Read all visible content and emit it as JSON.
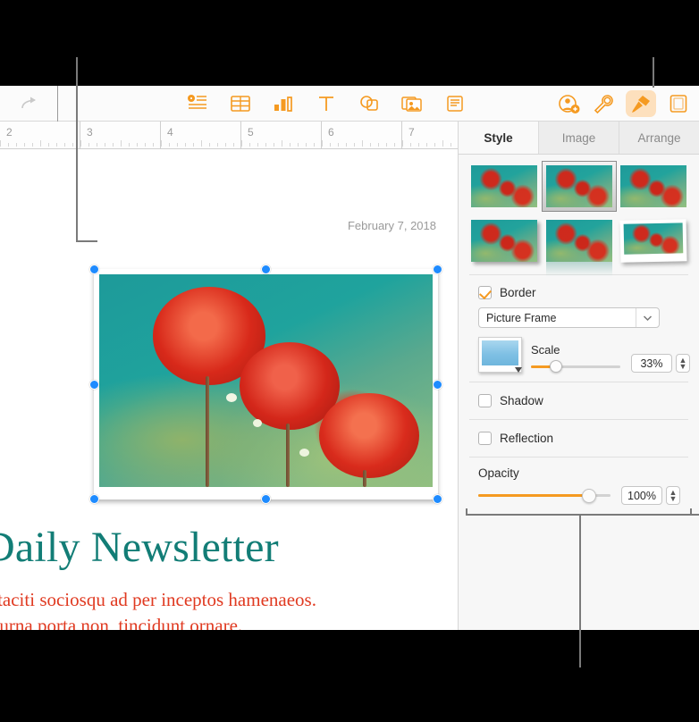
{
  "app": {
    "toolbar": {
      "redo_label": "redo",
      "items": [
        {
          "name": "insert-list-icon",
          "label": "Insert"
        },
        {
          "name": "table-icon",
          "label": "Table"
        },
        {
          "name": "chart-icon",
          "label": "Chart"
        },
        {
          "name": "text-icon",
          "label": "Text"
        },
        {
          "name": "shape-icon",
          "label": "Shape"
        },
        {
          "name": "media-icon",
          "label": "Media"
        },
        {
          "name": "comment-icon",
          "label": "Comment"
        }
      ],
      "right_items": [
        {
          "name": "collaborate-icon",
          "label": "Collaborate"
        },
        {
          "name": "settings-wrench-icon",
          "label": "Settings"
        },
        {
          "name": "format-brush-icon",
          "label": "Format"
        },
        {
          "name": "document-icon",
          "label": "Document"
        }
      ]
    }
  },
  "ruler": {
    "marks": [
      "2",
      "3",
      "4",
      "5",
      "6",
      "7"
    ]
  },
  "document": {
    "date": "February 7, 2018",
    "headline": "Daily Newsletter",
    "body_line1": "t taciti sociosqu ad per inceptos hamenaeos.",
    "body_line2": "s urna porta non, tincidunt ornare."
  },
  "sidebar": {
    "tabs": [
      {
        "label": "Style",
        "active": true
      },
      {
        "label": "Image",
        "active": false
      },
      {
        "label": "Arrange",
        "active": false
      }
    ],
    "styles": {
      "row1": [
        {
          "name": "style-plain",
          "selected": false
        },
        {
          "name": "style-picture-frame",
          "selected": true
        },
        {
          "name": "style-thin-border",
          "selected": false
        }
      ],
      "row2": [
        {
          "name": "style-drop-shadow",
          "selected": false
        },
        {
          "name": "style-reflection",
          "selected": false
        },
        {
          "name": "style-tilted-frame",
          "selected": false
        }
      ]
    },
    "border": {
      "checkbox_label": "Border",
      "checked": true,
      "type_value": "Picture Frame",
      "color_label": "border-color-well",
      "scale_label": "Scale",
      "scale_value": "33%",
      "scale_percent": 33
    },
    "shadow": {
      "checkbox_label": "Shadow",
      "checked": false
    },
    "reflection": {
      "checkbox_label": "Reflection",
      "checked": false
    },
    "opacity": {
      "label": "Opacity",
      "value": "100%",
      "percent": 100
    }
  },
  "colors": {
    "accent_orange": "#f59a21",
    "headline_teal": "#127d76",
    "body_red": "#e03a21",
    "handle_blue": "#1e8bff",
    "callout_gray": "#7a7a7a",
    "sidebar_bg": "#f7f7f7"
  }
}
